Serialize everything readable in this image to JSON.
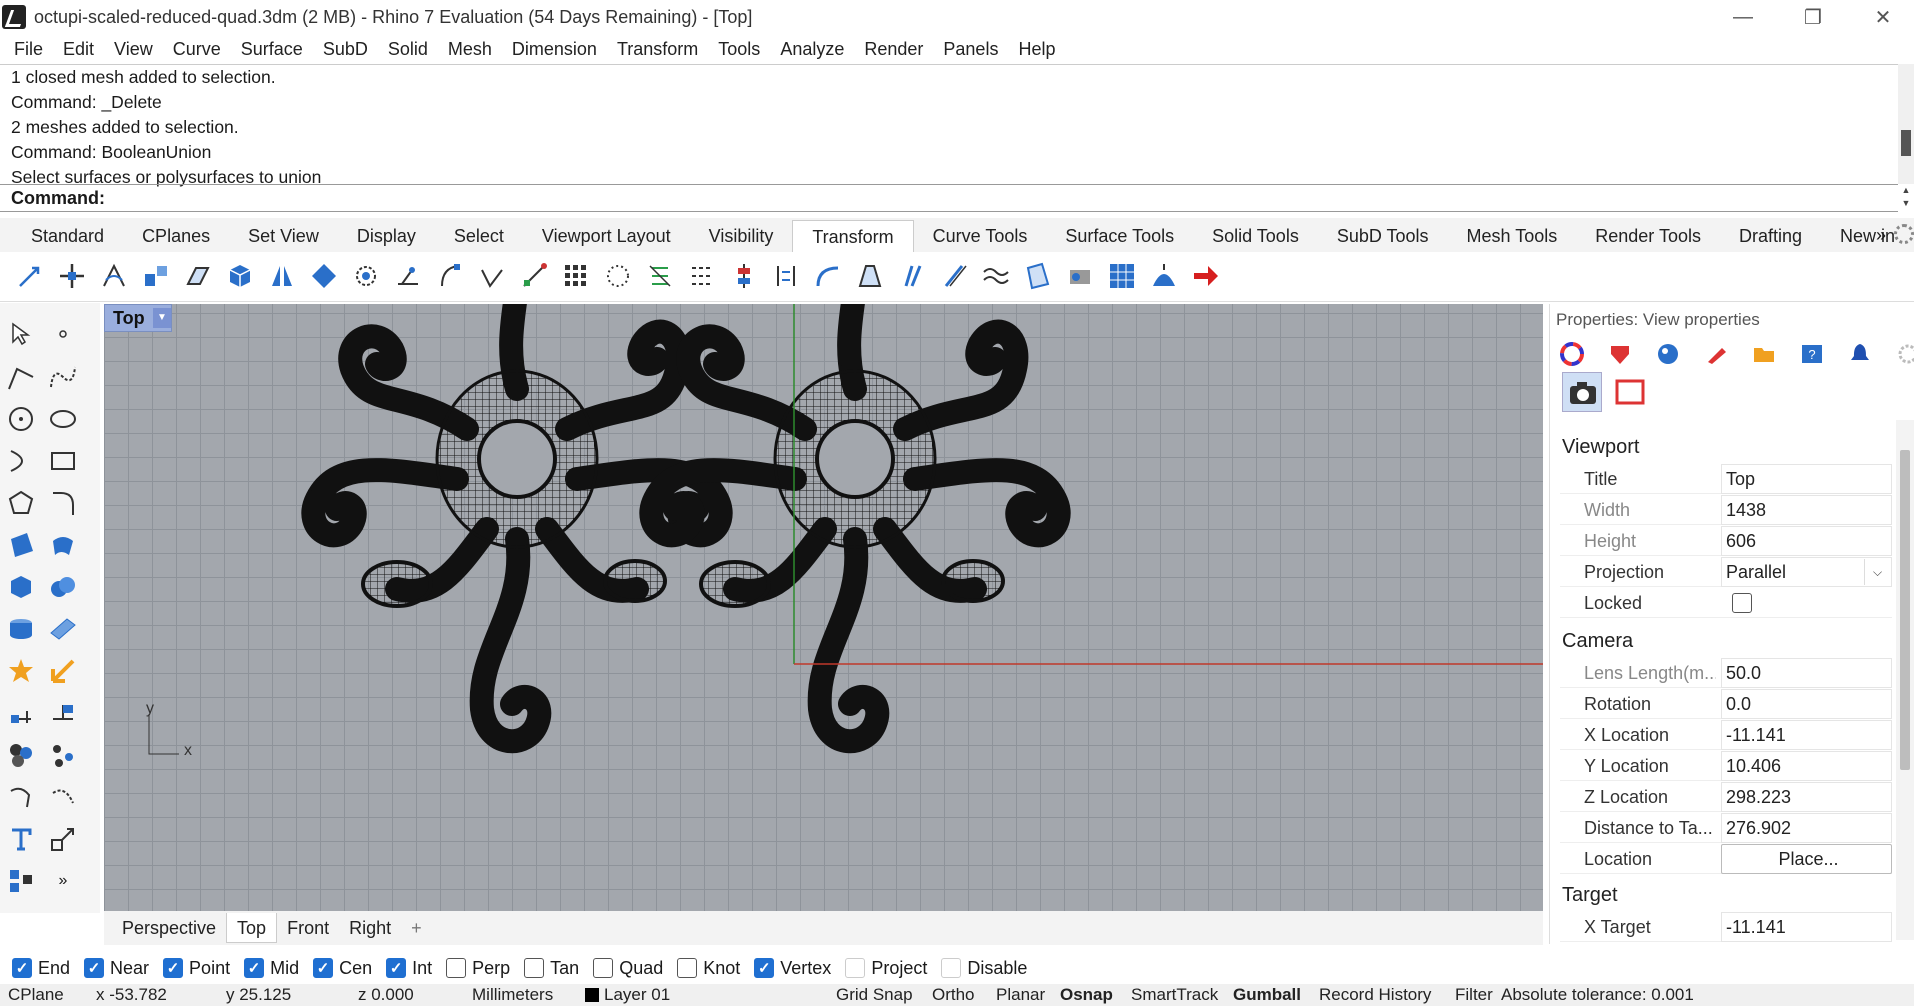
{
  "title_bar": {
    "title": "octupi-scaled-reduced-quad.3dm (2 MB) - Rhino 7 Evaluation (54 Days Remaining) - [Top]",
    "minimize": "—",
    "restore": "❐",
    "close": "✕"
  },
  "menu": [
    "File",
    "Edit",
    "View",
    "Curve",
    "Surface",
    "SubD",
    "Solid",
    "Mesh",
    "Dimension",
    "Transform",
    "Tools",
    "Analyze",
    "Render",
    "Panels",
    "Help"
  ],
  "command_history": [
    "1 closed mesh added to selection.",
    "Command: _Delete",
    "2 meshes added to selection.",
    "Command: BooleanUnion",
    "Select surfaces or polysurfaces to union"
  ],
  "command_prompt": "Command:",
  "toolbar_tabs": [
    "Standard",
    "CPlanes",
    "Set View",
    "Display",
    "Select",
    "Viewport Layout",
    "Visibility",
    "Transform",
    "Curve Tools",
    "Surface Tools",
    "Solid Tools",
    "SubD Tools",
    "Mesh Tools",
    "Render Tools",
    "Drafting",
    "New in"
  ],
  "active_toolbar_tab": "Transform",
  "tab_overflow": "»",
  "viewport": {
    "title": "Top",
    "arrow": "▼",
    "axis_x": "x",
    "axis_y": "y"
  },
  "viewport_tabs": [
    "Perspective",
    "Top",
    "Front",
    "Right"
  ],
  "active_viewport_tab": "Top",
  "viewport_tab_add": "+",
  "osnaps": [
    {
      "label": "End",
      "on": true
    },
    {
      "label": "Near",
      "on": true
    },
    {
      "label": "Point",
      "on": true
    },
    {
      "label": "Mid",
      "on": true
    },
    {
      "label": "Cen",
      "on": true
    },
    {
      "label": "Int",
      "on": true
    },
    {
      "label": "Perp",
      "on": false
    },
    {
      "label": "Tan",
      "on": false
    },
    {
      "label": "Quad",
      "on": false
    },
    {
      "label": "Knot",
      "on": false
    },
    {
      "label": "Vertex",
      "on": true
    },
    {
      "label": "Project",
      "on": false
    },
    {
      "label": "Disable",
      "on": false
    }
  ],
  "status": {
    "cplane": "CPlane",
    "x": "x -53.782",
    "y": "y 25.125",
    "z": "z 0.000",
    "units": "Millimeters",
    "layer": "Layer 01",
    "grid_snap": "Grid Snap",
    "ortho": "Ortho",
    "planar": "Planar",
    "osnap": "Osnap",
    "smarttrack": "SmartTrack",
    "gumball": "Gumball",
    "record_history": "Record History",
    "filter": "Filter",
    "tolerance": "Absolute tolerance: 0.001"
  },
  "properties": {
    "title": "Properties: View properties",
    "viewport_section": "Viewport",
    "viewport_rows": [
      {
        "label": "Title",
        "value": "Top"
      },
      {
        "label": "Width",
        "value": "1438"
      },
      {
        "label": "Height",
        "value": "606"
      },
      {
        "label": "Projection",
        "value": "Parallel"
      },
      {
        "label": "Locked",
        "value": ""
      }
    ],
    "camera_section": "Camera",
    "camera_rows": [
      {
        "label": "Lens Length(m...",
        "value": "50.0"
      },
      {
        "label": "Rotation",
        "value": "0.0"
      },
      {
        "label": "X Location",
        "value": "-11.141"
      },
      {
        "label": "Y Location",
        "value": "10.406"
      },
      {
        "label": "Z Location",
        "value": "298.223"
      },
      {
        "label": "Distance to Ta...",
        "value": "276.902"
      },
      {
        "label": "Location",
        "value": "Place..."
      }
    ],
    "target_section": "Target",
    "target_rows": [
      {
        "label": "X Target",
        "value": "-11.141"
      }
    ]
  },
  "more_tools": "»",
  "colors": {
    "accent": "#1f6fd1",
    "viewport_bg": "#a3a7ad",
    "grid": "#8e939a",
    "x_axis": "#c0392b",
    "y_axis": "#2e8b2e",
    "viewport_label": "#9aaedd"
  }
}
